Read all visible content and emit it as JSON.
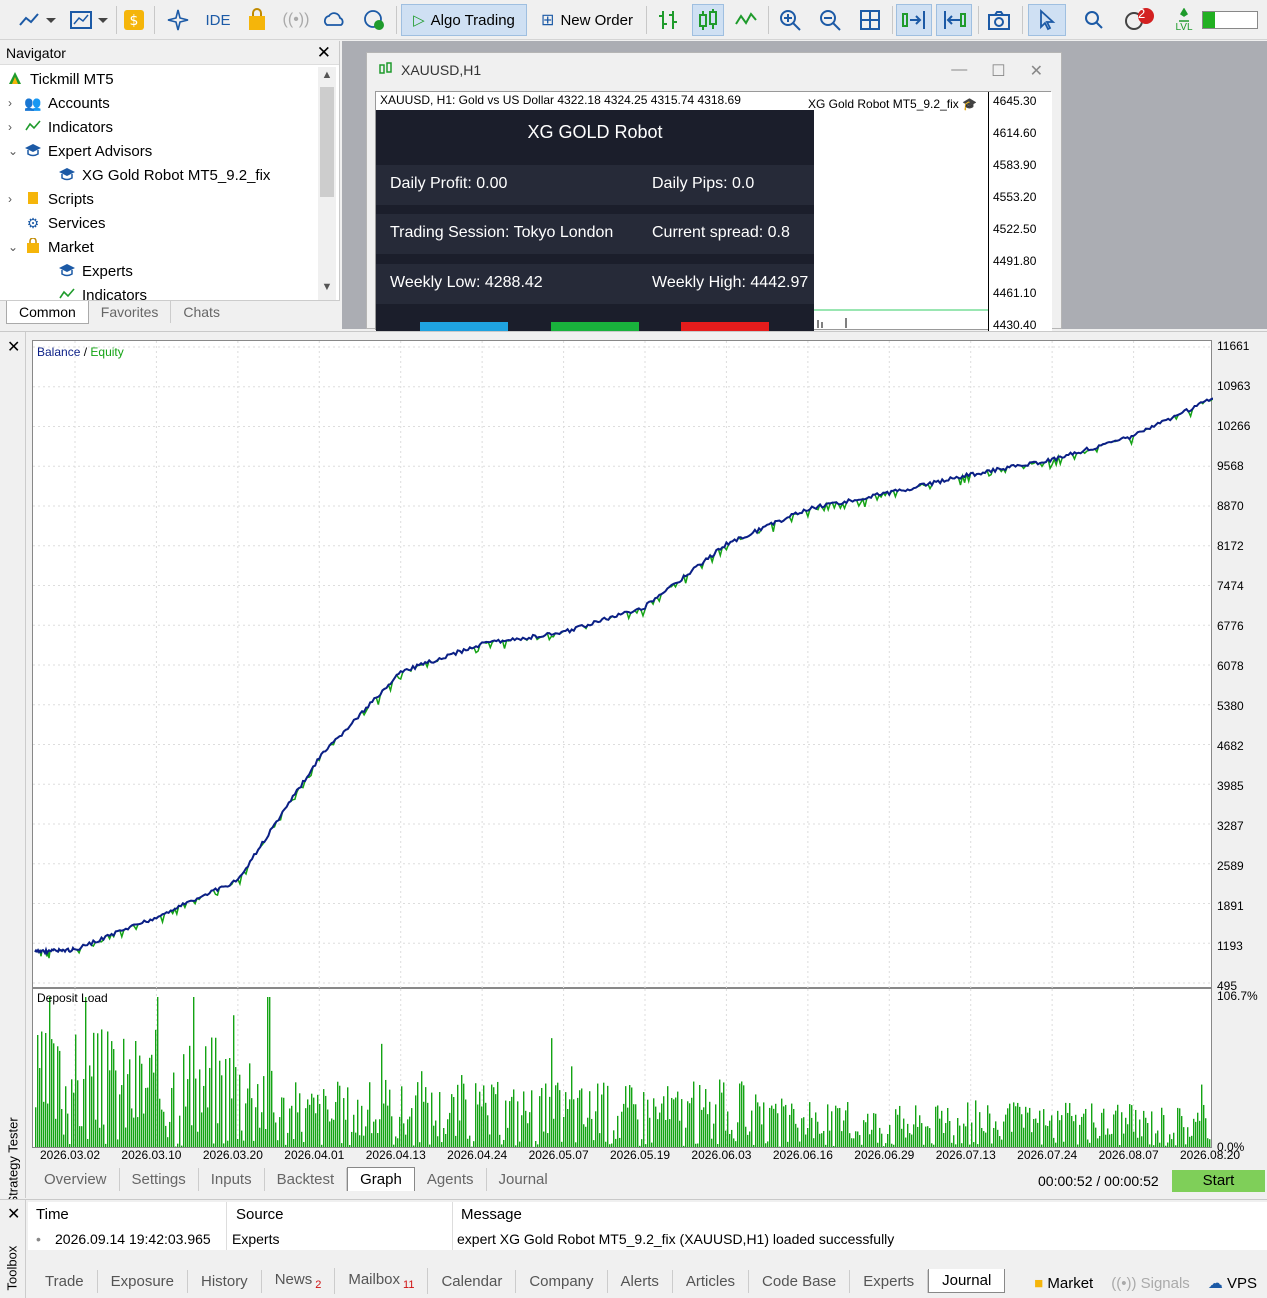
{
  "toolbar": {
    "ide_label": "IDE",
    "algo_trading_label": "Algo Trading",
    "new_order_label": "New Order",
    "notifications_count": "2",
    "lvl_label": "LVL"
  },
  "navigator": {
    "title": "Navigator",
    "items": [
      {
        "label": "Tickmill MT5"
      },
      {
        "label": "Accounts"
      },
      {
        "label": "Indicators"
      },
      {
        "label": "Expert Advisors"
      },
      {
        "label": "XG Gold Robot MT5_9.2_fix"
      },
      {
        "label": "Scripts"
      },
      {
        "label": "Services"
      },
      {
        "label": "Market"
      },
      {
        "label": "Experts"
      },
      {
        "label": "Indicators"
      }
    ],
    "tabs": [
      "Common",
      "Favorites",
      "Chats"
    ]
  },
  "chart_window": {
    "title": "XAUUSD,H1",
    "info": "XAUUSD, H1:  Gold vs US Dollar   4322.18 4324.25 4315.74 4318.69",
    "ea_label": "XG Gold Robot MT5_9.2_fix",
    "price_levels": [
      "4645.30",
      "4614.60",
      "4583.90",
      "4553.20",
      "4522.50",
      "4491.80",
      "4461.10",
      "4430.40"
    ],
    "robot_panel": {
      "title": "XG GOLD Robot",
      "daily_profit": "Daily Profit: 0.00",
      "daily_pips": "Daily Pips:   0.0",
      "trading_session": "Trading Session: Tokyo London",
      "current_spread": "Current spread: 0.8",
      "weekly_low": "Weekly Low: 4288.42",
      "weekly_high": "Weekly High: 4442.97",
      "button_colors": [
        "#1fa3e0",
        "#19b13c",
        "#e51c1c"
      ]
    }
  },
  "strategy_tester": {
    "side_label": "Strategy Tester",
    "tabs": [
      "Overview",
      "Settings",
      "Inputs",
      "Backtest",
      "Graph",
      "Agents",
      "Journal"
    ],
    "selected_tab": "Graph",
    "timer": "00:00:52 / 00:00:52",
    "start_label": "Start",
    "chart_data": {
      "type": "line",
      "legend": [
        "Balance",
        "Equity"
      ],
      "legend_sep": "/",
      "colors": {
        "balance": "#0b1f86",
        "equity": "#14a314",
        "deposit_load": "#14a314"
      },
      "y_ticks": [
        "11661",
        "10963",
        "10266",
        "9568",
        "8870",
        "8172",
        "7474",
        "6776",
        "6078",
        "5380",
        "4682",
        "3985",
        "3287",
        "2589",
        "1891",
        "1193",
        "495"
      ],
      "ylim": [
        495,
        11661
      ],
      "x_ticks": [
        "2026.03.02",
        "2026.03.10",
        "2026.03.20",
        "2026.04.01",
        "2026.04.13",
        "2026.04.24",
        "2026.05.07",
        "2026.05.19",
        "2026.06.03",
        "2026.06.16",
        "2026.06.29",
        "2026.07.13",
        "2026.07.24",
        "2026.08.07",
        "2026.08.20"
      ],
      "balance": [
        {
          "x": "2026.03.02",
          "y": 1080
        },
        {
          "x": "2026.03.10",
          "y": 1650
        },
        {
          "x": "2026.03.20",
          "y": 2300
        },
        {
          "x": "2026.04.01",
          "y": 4450
        },
        {
          "x": "2026.04.13",
          "y": 5950
        },
        {
          "x": "2026.04.24",
          "y": 6450
        },
        {
          "x": "2026.05.07",
          "y": 6650
        },
        {
          "x": "2026.05.19",
          "y": 7100
        },
        {
          "x": "2026.06.03",
          "y": 8200
        },
        {
          "x": "2026.06.16",
          "y": 8820
        },
        {
          "x": "2026.06.29",
          "y": 9100
        },
        {
          "x": "2026.07.13",
          "y": 9420
        },
        {
          "x": "2026.07.24",
          "y": 9680
        },
        {
          "x": "2026.08.07",
          "y": 10100
        },
        {
          "x": "2026.08.20",
          "y": 10780
        }
      ],
      "deposit_load": {
        "title": "Deposit Load",
        "y_ticks": [
          "106.7%",
          "0.0%"
        ],
        "ylim": [
          0,
          106.7
        ]
      }
    }
  },
  "toolbox": {
    "side_label": "Toolbox",
    "columns": [
      "Time",
      "Source",
      "Message"
    ],
    "rows": [
      {
        "time": "2026.09.14 19:42:03.965",
        "source": "Experts",
        "message": "expert XG Gold Robot MT5_9.2_fix (XAUUSD,H1) loaded successfully"
      }
    ],
    "tabs": [
      {
        "label": "Trade"
      },
      {
        "label": "Exposure"
      },
      {
        "label": "History"
      },
      {
        "label": "News",
        "badge": "2"
      },
      {
        "label": "Mailbox",
        "badge": "11"
      },
      {
        "label": "Calendar"
      },
      {
        "label": "Company"
      },
      {
        "label": "Alerts"
      },
      {
        "label": "Articles"
      },
      {
        "label": "Code Base"
      },
      {
        "label": "Experts"
      },
      {
        "label": "Journal"
      }
    ],
    "selected_tab": "Journal",
    "right": {
      "market": "Market",
      "signals": "Signals",
      "vps": "VPS"
    }
  }
}
